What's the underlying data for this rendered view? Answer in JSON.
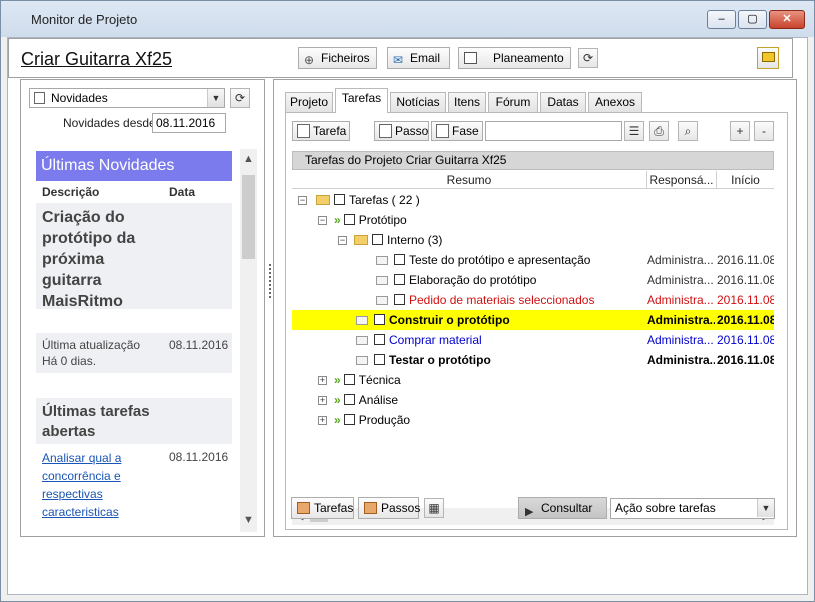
{
  "window": {
    "title": "Monitor de Projeto"
  },
  "page": {
    "title": "Criar Guitarra Xf25"
  },
  "left": {
    "feed_select": "Novidades",
    "since_label": "Novidades desde",
    "since_value": "08.11.2016",
    "feed_title": "Últimas Novidades",
    "col_desc": "Descrição",
    "col_date": "Data",
    "news_text": "Criação do protótipo da próxima guitarra MaisRitmo",
    "last_update_label": "Última atualização",
    "last_update_date": "08.11.2016",
    "last_update_ago": "Há 0 dias.",
    "open_tasks_title": "Últimas tarefas abertas",
    "open_task_link": "Analisar qual a concorrência e respectivas caracteristicas",
    "open_task_date": "08.11.2016"
  },
  "tabs": [
    "Projeto",
    "Tarefas",
    "Notícias",
    "Itens",
    "Fórum",
    "Datas",
    "Anexos"
  ],
  "toolbar": {
    "tarefa": "Tarefa",
    "passo": "Passo",
    "fase": "Fase",
    "search_value": ""
  },
  "grid": {
    "caption": "Tarefas do Projeto Criar Guitarra Xf25",
    "col_summary": "Resumo",
    "col_resp": "Responsá...",
    "col_start": "Início",
    "rows": [
      {
        "name": "Tarefas ( 22 )",
        "resp": "",
        "start": ""
      },
      {
        "name": "Protótipo",
        "resp": "",
        "start": ""
      },
      {
        "name": "Interno (3)",
        "resp": "",
        "start": ""
      },
      {
        "name": "Teste do protótipo e apresentação",
        "resp": "Administra...",
        "start": "2016.11.08"
      },
      {
        "name": "Elaboração do protótipo",
        "resp": "Administra...",
        "start": "2016.11.08"
      },
      {
        "name": "Pedido de materiais seleccionados",
        "resp": "Administra...",
        "start": "2016.11.08"
      },
      {
        "name": "Construir o protótipo",
        "resp": "Administra...",
        "start": "2016.11.08"
      },
      {
        "name": "Comprar material",
        "resp": "Administra...",
        "start": "2016.11.08"
      },
      {
        "name": "Testar o protótipo",
        "resp": "Administra...",
        "start": "2016.11.08"
      },
      {
        "name": "Técnica",
        "resp": "",
        "start": ""
      },
      {
        "name": "Análise",
        "resp": "",
        "start": ""
      },
      {
        "name": "Produção",
        "resp": "",
        "start": ""
      }
    ]
  },
  "bottombar": {
    "tarefas": "Tarefas",
    "passos": "Passos",
    "consultar": "Consultar",
    "action_select": "Ação sobre tarefas"
  },
  "footer": {
    "ficheiros": "Ficheiros",
    "email": "Email",
    "planeamento": "Planeamento"
  },
  "colors": {
    "accent": "#7b7bee",
    "highlight": "#ffff00",
    "red": "#d01010",
    "blue": "#0000cc"
  }
}
